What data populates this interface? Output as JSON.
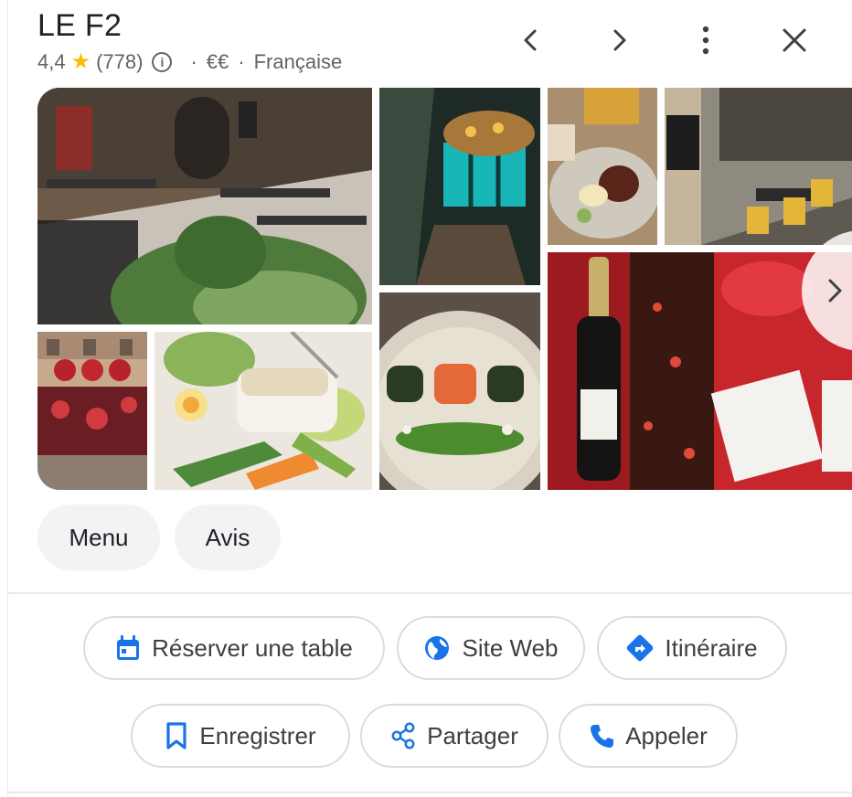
{
  "header": {
    "title": "LE F2",
    "rating": "4,4",
    "review_count": "(778)",
    "price": "€€",
    "category": "Française",
    "separator": "·"
  },
  "nav_icons": [
    "chevron-left-icon",
    "chevron-right-icon",
    "more-vert-icon",
    "close-icon"
  ],
  "tabs": [
    {
      "label": "Menu"
    },
    {
      "label": "Avis"
    }
  ],
  "actions": {
    "row1": [
      {
        "label": "Réserver une table",
        "icon": "calendar-icon"
      },
      {
        "label": "Site Web",
        "icon": "globe-icon"
      },
      {
        "label": "Itinéraire",
        "icon": "directions-icon"
      }
    ],
    "row2": [
      {
        "label": "Enregistrer",
        "icon": "bookmark-icon"
      },
      {
        "label": "Partager",
        "icon": "share-icon"
      },
      {
        "label": "Appeler",
        "icon": "phone-icon"
      }
    ]
  },
  "colors": {
    "accent_blue": "#1a73e8",
    "star": "#fbbc04",
    "chip_bg": "#f1f3f4",
    "border": "#dadce0"
  }
}
